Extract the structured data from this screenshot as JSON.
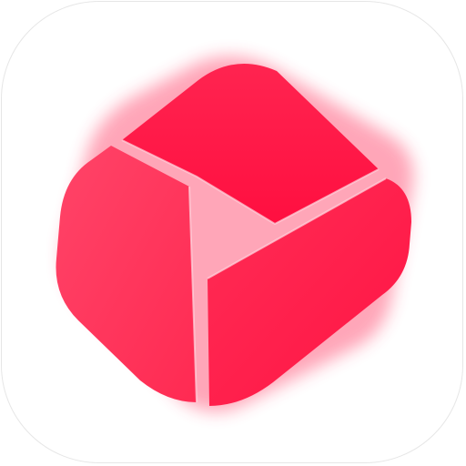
{
  "app_icon": {
    "icon_name": "play-video-app-icon",
    "tile_color": "#ffffff",
    "tile_border_color": "#e6e6e6",
    "accent_color": "#ff1747",
    "accent_light": "#ff4a6c",
    "gap_color": "#ffe3ea"
  }
}
